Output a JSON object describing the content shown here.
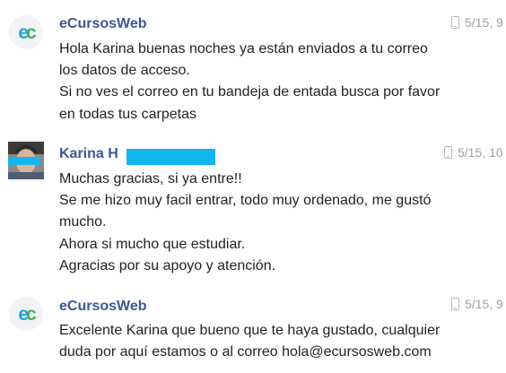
{
  "messages": [
    {
      "sender": "eCursosWeb",
      "avatar": "ecursosweb-logo",
      "avatar_text": "ec",
      "timestamp": "5/15, 9",
      "device_icon": "mobile-phone-icon",
      "lines": [
        "Hola Karina buenas noches ya están enviados a tu correo",
        "los datos de acceso.",
        "Si no ves el correo en tu bandeja de entada busca por favor",
        "en todas tus carpetas"
      ]
    },
    {
      "sender": "Karina H",
      "avatar": "user-photo",
      "timestamp": "5/15, 10",
      "device_icon": "mobile-phone-icon",
      "lines": [
        "Muchas gracias, si ya entre!!",
        "Se me hizo muy facil entrar, todo muy ordenado, me gustó",
        "mucho.",
        "Ahora si mucho que estudiar.",
        "Agracias por su apoyo y atención."
      ]
    },
    {
      "sender": "eCursosWeb",
      "avatar": "ecursosweb-logo",
      "avatar_text": "ec",
      "timestamp": "5/15, 9",
      "device_icon": "mobile-phone-icon",
      "lines": [
        "Excelente Karina que bueno que te haya gustado, cualquier",
        "duda por aquí estamos o al correo hola@ecursosweb.com"
      ]
    }
  ],
  "colors": {
    "sender_name": "#3a5894",
    "redaction": "#11b6ee",
    "logo_e": "#1aa4e0",
    "logo_c": "#42b35c",
    "timestamp": "#9aa0a6"
  }
}
